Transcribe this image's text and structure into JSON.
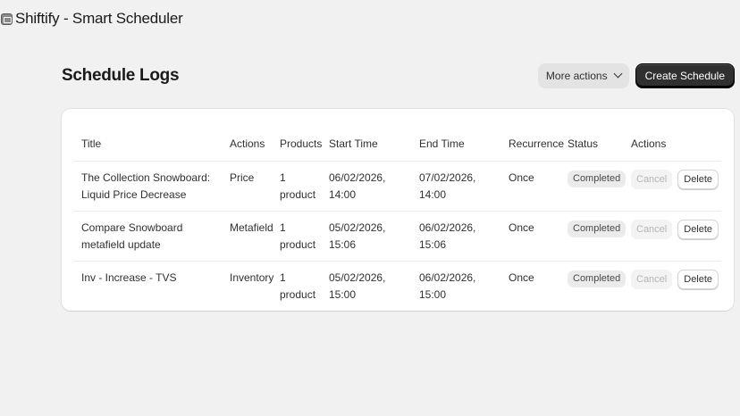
{
  "app": {
    "title": "Shiftify - Smart Scheduler",
    "icon": "app-logo-icon"
  },
  "page": {
    "title": "Schedule Logs",
    "more_actions_label": "More actions",
    "create_label": "Create Schedule"
  },
  "table": {
    "headers": [
      "Title",
      "Actions",
      "Products",
      "Start Time",
      "End Time",
      "Recurrence",
      "Status",
      "Actions"
    ],
    "rows": [
      {
        "title": "The Collection Snowboard: Liquid Price Decrease",
        "action": "Price",
        "products": "1 product",
        "start": "06/02/2026, 14:00",
        "end": "07/02/2026, 14:00",
        "recurrence": "Once",
        "status": "Completed",
        "cancel": "Cancel",
        "delete": "Delete"
      },
      {
        "title": "Compare Snowboard metafield update",
        "action": "Metafield",
        "products": "1 product",
        "start": "05/02/2026, 15:06",
        "end": "06/02/2026, 15:06",
        "recurrence": "Once",
        "status": "Completed",
        "cancel": "Cancel",
        "delete": "Delete"
      },
      {
        "title": "Inv - Increase - TVS",
        "action": "Inventory",
        "products": "1 product",
        "start": "05/02/2026, 15:00",
        "end": "06/02/2026, 15:00",
        "recurrence": "Once",
        "status": "Completed",
        "cancel": "Cancel",
        "delete": "Delete"
      }
    ]
  },
  "colors": {
    "background": "#f1f1f1",
    "primary_button": "#303030",
    "badge": "#ebebeb"
  }
}
